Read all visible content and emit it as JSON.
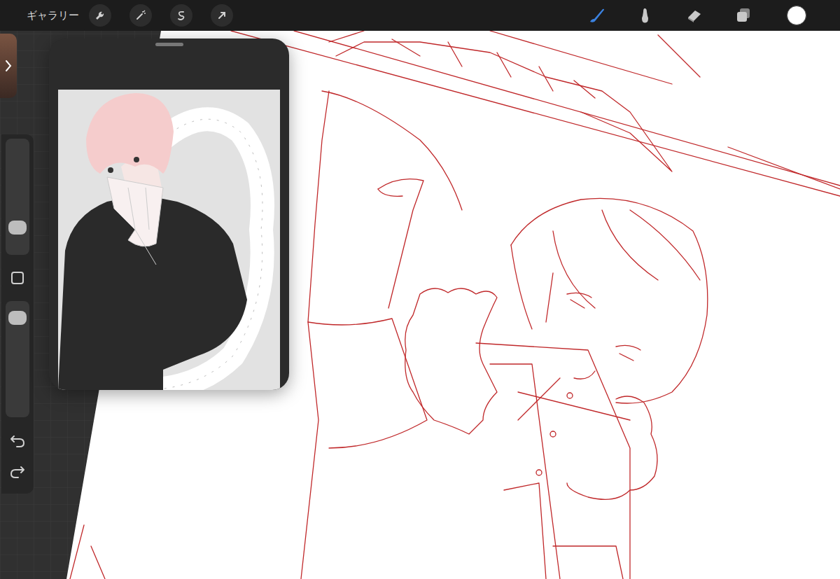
{
  "toolbar": {
    "gallery": "ギャラリー",
    "tools": [
      {
        "selected": true
      },
      {
        "selected": false
      },
      {
        "selected": false
      },
      {
        "selected": false
      }
    ],
    "color": "#ffffff"
  },
  "sidebar": {
    "sliders": [
      {
        "level": 0.18
      },
      {
        "level": 0.93
      }
    ]
  }
}
